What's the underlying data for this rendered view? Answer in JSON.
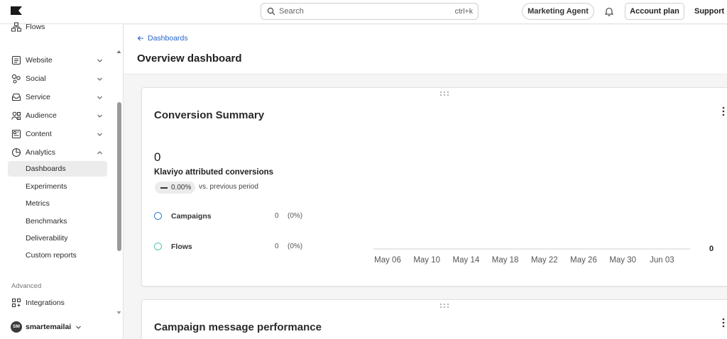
{
  "topbar": {
    "search_placeholder": "Search",
    "search_shortcut": "ctrl+k",
    "marketing_agent": "Marketing Agent",
    "account_plan": "Account plan",
    "support": "Support"
  },
  "sidebar": {
    "partial_top": "Flows",
    "items": [
      {
        "label": "Website",
        "icon": "website-icon"
      },
      {
        "label": "Social",
        "icon": "social-icon"
      },
      {
        "label": "Service",
        "icon": "inbox-icon"
      },
      {
        "label": "Audience",
        "icon": "people-icon"
      },
      {
        "label": "Content",
        "icon": "content-icon"
      },
      {
        "label": "Analytics",
        "icon": "analytics-icon"
      }
    ],
    "analytics_sub": [
      "Dashboards",
      "Experiments",
      "Metrics",
      "Benchmarks",
      "Deliverability",
      "Custom reports"
    ],
    "active_sub": "Dashboards",
    "advanced_label": "Advanced",
    "integrations": "Integrations",
    "account": {
      "initials": "SM",
      "name": "smartemailai"
    }
  },
  "header": {
    "breadcrumb": "Dashboards",
    "title": "Overview dashboard"
  },
  "conversion_card": {
    "title": "Conversion Summary",
    "total": "0",
    "metric_label": "Klaviyo attributed conversions",
    "delta": "0.00%",
    "vs_label": "vs. previous period",
    "legend": [
      {
        "name": "Campaigns",
        "count": "0",
        "pct": "(0%)",
        "color": "#2f7fd6"
      },
      {
        "name": "Flows",
        "count": "0",
        "pct": "(0%)",
        "color": "#55c3b0"
      }
    ],
    "end_value": "0"
  },
  "campaign_card": {
    "title": "Campaign message performance"
  },
  "chart_data": {
    "type": "line",
    "x": [
      "May 06",
      "May 10",
      "May 14",
      "May 18",
      "May 22",
      "May 26",
      "May 30",
      "Jun 03"
    ],
    "series": [
      {
        "name": "Campaigns",
        "values": [
          0,
          0,
          0,
          0,
          0,
          0,
          0,
          0
        ]
      },
      {
        "name": "Flows",
        "values": [
          0,
          0,
          0,
          0,
          0,
          0,
          0,
          0
        ]
      }
    ],
    "end_label": "0",
    "grid": false
  }
}
